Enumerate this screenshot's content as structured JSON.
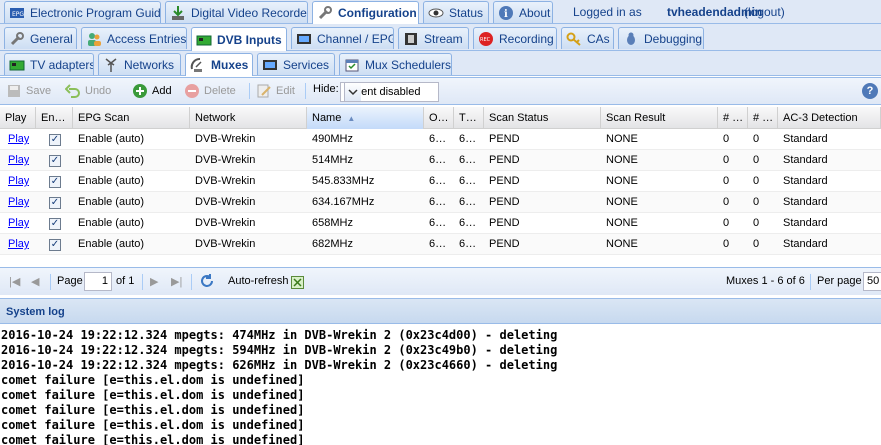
{
  "topnav": {
    "tabs": [
      {
        "label": "Electronic Program Guide",
        "icon": "epg-icon"
      },
      {
        "label": "Digital Video Recorder",
        "icon": "dvr-icon"
      },
      {
        "label": "Configuration",
        "icon": "wrench-icon"
      },
      {
        "label": "Status",
        "icon": "eye-icon"
      },
      {
        "label": "About",
        "icon": "info-icon"
      }
    ],
    "login_text": "Logged in as",
    "username": "tvheadendadmin",
    "logout": "(logout)"
  },
  "confnav": {
    "tabs": [
      {
        "label": "General"
      },
      {
        "label": "Access Entries"
      },
      {
        "label": "DVB Inputs"
      },
      {
        "label": "Channel / EPG"
      },
      {
        "label": "Stream"
      },
      {
        "label": "Recording"
      },
      {
        "label": "CAs"
      },
      {
        "label": "Debugging"
      }
    ]
  },
  "dvbnav": {
    "tabs": [
      {
        "label": "TV adapters"
      },
      {
        "label": "Networks"
      },
      {
        "label": "Muxes"
      },
      {
        "label": "Services"
      },
      {
        "label": "Mux Schedulers"
      }
    ]
  },
  "toolbar": {
    "save": "Save",
    "undo": "Undo",
    "add": "Add",
    "delete": "Delete",
    "edit": "Edit",
    "hide_label": "Hide:",
    "hide_value": "Parent disabled"
  },
  "grid": {
    "columns": [
      "Play",
      "En…",
      "EPG Scan",
      "Network",
      "Name",
      "O…",
      "T…",
      "Scan Status",
      "Scan Result",
      "# …",
      "# …",
      "AC-3 Detection"
    ],
    "rows": [
      {
        "play": "Play",
        "epg": "Enable (auto)",
        "network": "DVB-Wrekin",
        "name": "490MHz",
        "o": "6…",
        "t": "6…",
        "status": "PEND",
        "result": "NONE",
        "n1": "0",
        "n2": "0",
        "ac3": "Standard"
      },
      {
        "play": "Play",
        "epg": "Enable (auto)",
        "network": "DVB-Wrekin",
        "name": "514MHz",
        "o": "6…",
        "t": "6…",
        "status": "PEND",
        "result": "NONE",
        "n1": "0",
        "n2": "0",
        "ac3": "Standard"
      },
      {
        "play": "Play",
        "epg": "Enable (auto)",
        "network": "DVB-Wrekin",
        "name": "545.833MHz",
        "o": "6…",
        "t": "6…",
        "status": "PEND",
        "result": "NONE",
        "n1": "0",
        "n2": "0",
        "ac3": "Standard"
      },
      {
        "play": "Play",
        "epg": "Enable (auto)",
        "network": "DVB-Wrekin",
        "name": "634.167MHz",
        "o": "6…",
        "t": "6…",
        "status": "PEND",
        "result": "NONE",
        "n1": "0",
        "n2": "0",
        "ac3": "Standard"
      },
      {
        "play": "Play",
        "epg": "Enable (auto)",
        "network": "DVB-Wrekin",
        "name": "658MHz",
        "o": "6…",
        "t": "6…",
        "status": "PEND",
        "result": "NONE",
        "n1": "0",
        "n2": "0",
        "ac3": "Standard"
      },
      {
        "play": "Play",
        "epg": "Enable (auto)",
        "network": "DVB-Wrekin",
        "name": "682MHz",
        "o": "6…",
        "t": "6…",
        "status": "PEND",
        "result": "NONE",
        "n1": "0",
        "n2": "0",
        "ac3": "Standard"
      }
    ]
  },
  "paging": {
    "page_label": "Page",
    "page_value": "1",
    "of_label": "of 1",
    "autorefresh": "Auto-refresh",
    "summary": "Muxes 1 - 6 of 6",
    "perpage_label": "Per page",
    "perpage_value": "50"
  },
  "syslog": {
    "title": "System log",
    "lines": [
      "2016-10-24 19:22:12.324 mpegts: 474MHz in DVB-Wrekin 2 (0x23c4d00) - deleting",
      "2016-10-24 19:22:12.324 mpegts: 594MHz in DVB-Wrekin 2 (0x23c49b0) - deleting",
      "2016-10-24 19:22:12.324 mpegts: 626MHz in DVB-Wrekin 2 (0x23c4660) - deleting",
      "comet failure [e=this.el.dom is undefined]",
      "comet failure [e=this.el.dom is undefined]",
      "comet failure [e=this.el.dom is undefined]",
      "comet failure [e=this.el.dom is undefined]",
      "comet failure [e=this.el.dom is undefined]"
    ]
  },
  "colors": {
    "accent": "#15428b",
    "link": "#0000ff",
    "panel": "#dfe8f6"
  }
}
